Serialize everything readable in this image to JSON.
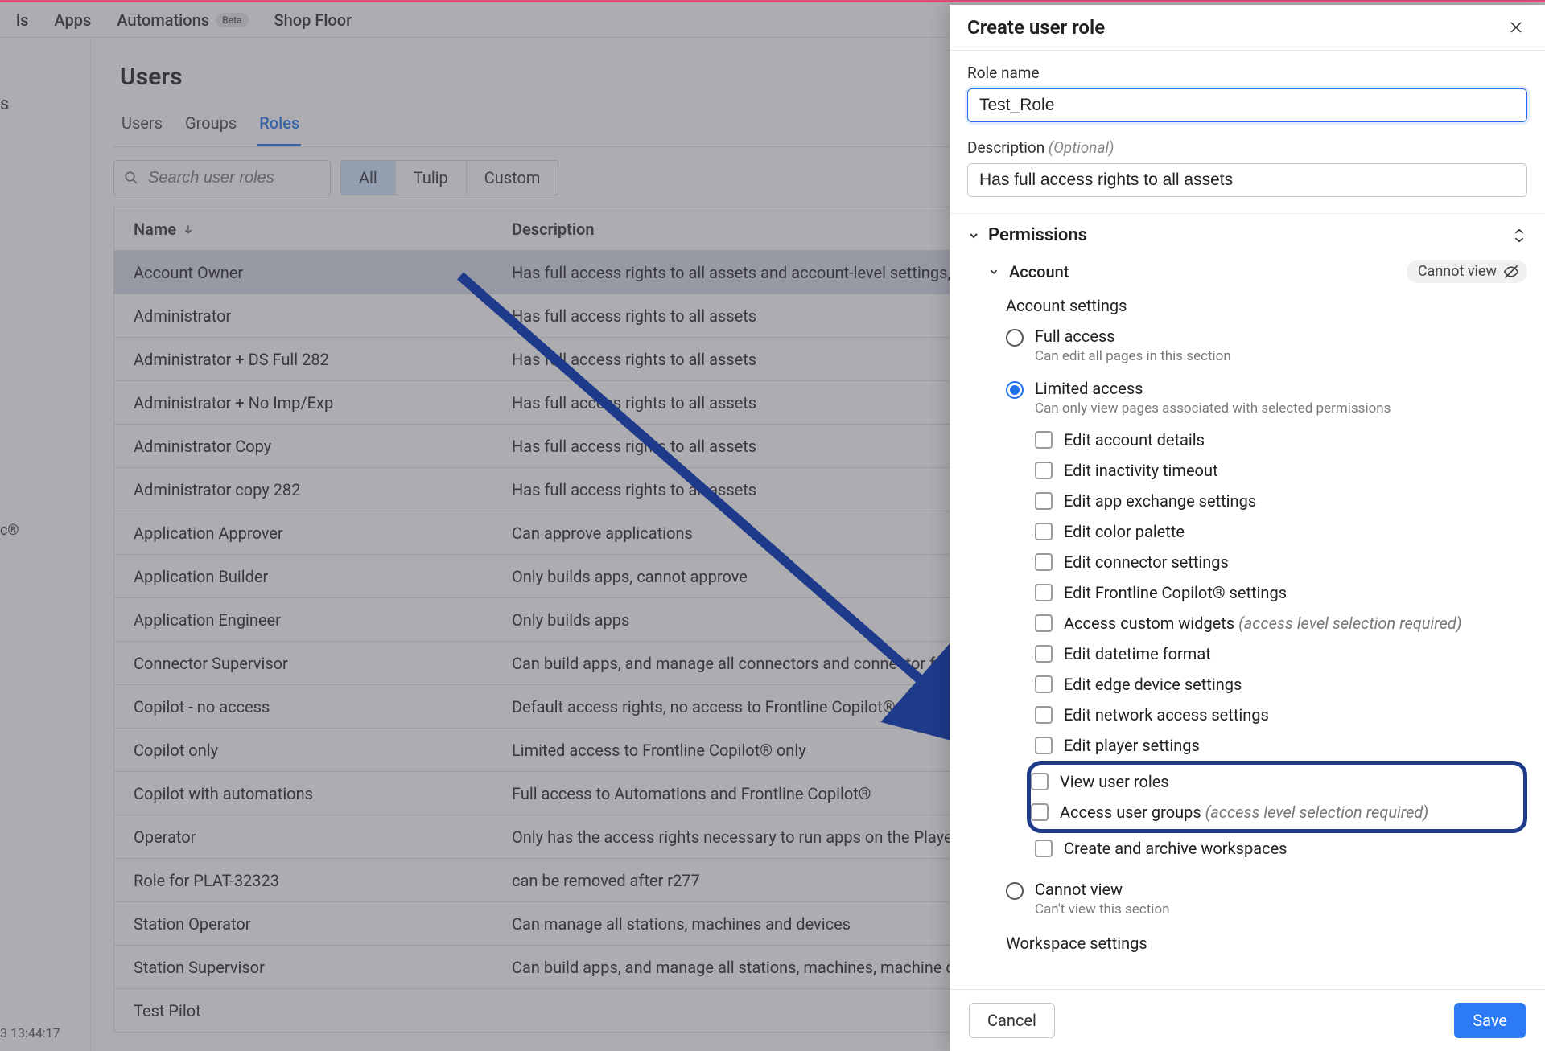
{
  "topnav": {
    "items": [
      "ls",
      "Apps",
      "Automations",
      "Shop Floor"
    ],
    "beta_badge": "Beta"
  },
  "gutter": {
    "frag1": "s",
    "frag2": "c®",
    "timestamp": "3 13:44:17"
  },
  "page": {
    "title": "Users",
    "tabs": [
      "Users",
      "Groups",
      "Roles"
    ],
    "active_tab": 2,
    "search_placeholder": "Search user roles",
    "filters": [
      "All",
      "Tulip",
      "Custom"
    ],
    "active_filter": 0,
    "columns": [
      "Name",
      "Description"
    ],
    "rows": [
      {
        "name": "Account Owner",
        "desc": "Has full access rights to all assets and account-level settings, and manages billing",
        "selected": true
      },
      {
        "name": "Administrator",
        "desc": "Has full access rights to all assets"
      },
      {
        "name": "Administrator + DS Full 282",
        "desc": "Has full access rights to all assets"
      },
      {
        "name": "Administrator + No Imp/Exp",
        "desc": "Has full access rights to all assets"
      },
      {
        "name": "Administrator Copy",
        "desc": "Has full access rights to all assets"
      },
      {
        "name": "Administrator copy 282",
        "desc": "Has full access rights to all assets"
      },
      {
        "name": "Application Approver",
        "desc": "Can approve applications"
      },
      {
        "name": "Application Builder",
        "desc": "Only builds apps, cannot approve"
      },
      {
        "name": "Application Engineer",
        "desc": "Only builds apps"
      },
      {
        "name": "Connector Supervisor",
        "desc": "Can build apps, and manage all connectors and connector functions"
      },
      {
        "name": "Copilot - no access",
        "desc": "Default access rights, no access to Frontline Copilot®"
      },
      {
        "name": "Copilot only",
        "desc": "Limited access to Frontline Copilot® only"
      },
      {
        "name": "Copilot with automations",
        "desc": "Full access to Automations and Frontline Copilot®"
      },
      {
        "name": "Operator",
        "desc": "Only has the access rights necessary to run apps on the Player"
      },
      {
        "name": "Role for PLAT-32323",
        "desc": "can be removed after r277"
      },
      {
        "name": "Station Operator",
        "desc": "Can manage all stations, machines and devices"
      },
      {
        "name": "Station Supervisor",
        "desc": "Can build apps, and manage all stations, machines, machine data sources, and devices"
      },
      {
        "name": "Test Pilot",
        "desc": ""
      }
    ]
  },
  "panel": {
    "title": "Create user role",
    "role_name_label": "Role name",
    "role_name_value": "Test_Role",
    "desc_label": "Description",
    "desc_optional": "(Optional)",
    "desc_value": "Has full access rights to all assets",
    "permissions_label": "Permissions",
    "account_label": "Account",
    "account_chip": "Cannot view",
    "subsect1": "Account settings",
    "radios": [
      {
        "label": "Full access",
        "desc": "Can edit all pages in this section"
      },
      {
        "label": "Limited access",
        "desc": "Can only view pages associated with selected permissions"
      },
      {
        "label": "Cannot view",
        "desc": "Can't view this section"
      }
    ],
    "selected_radio": 1,
    "hint_suffix": "(access level selection required)",
    "checks": [
      {
        "label": "Edit account details"
      },
      {
        "label": "Edit inactivity timeout"
      },
      {
        "label": "Edit app exchange settings"
      },
      {
        "label": "Edit color palette"
      },
      {
        "label": "Edit connector settings"
      },
      {
        "label": "Edit Frontline Copilot® settings"
      },
      {
        "label": "Access custom widgets",
        "hint": true
      },
      {
        "label": "Edit datetime format"
      },
      {
        "label": "Edit edge device settings"
      },
      {
        "label": "Edit network access settings"
      },
      {
        "label": "Edit player settings"
      },
      {
        "label": "View user roles"
      },
      {
        "label": "Access user groups",
        "hint": true
      },
      {
        "label": "Create and archive workspaces"
      }
    ],
    "highlight_indices": [
      11,
      12
    ],
    "subsect2": "Workspace settings",
    "cancel": "Cancel",
    "save": "Save"
  }
}
